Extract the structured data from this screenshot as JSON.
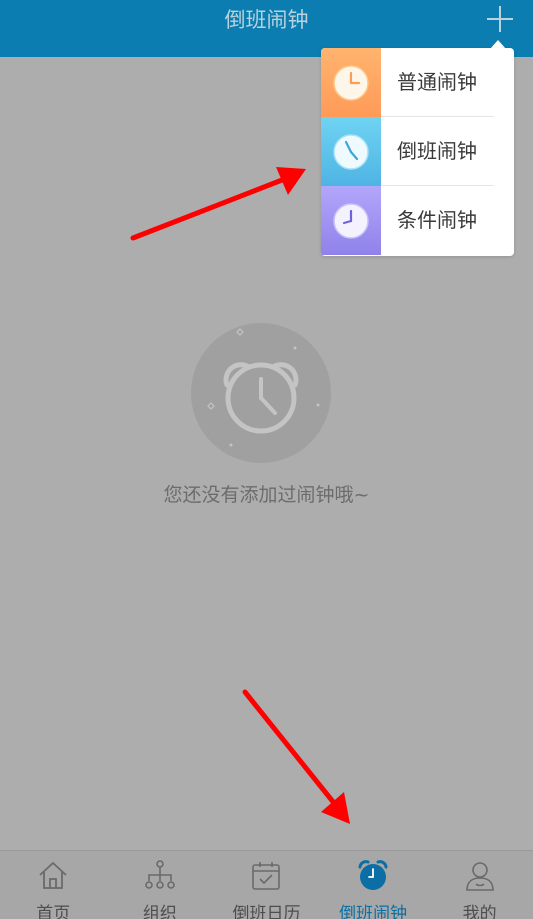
{
  "header": {
    "title": "倒班闹钟",
    "add_icon": "plus-icon"
  },
  "popup_menu": {
    "items": [
      {
        "label": "普通闹钟",
        "icon": "clock-icon",
        "color": "#ffa35e"
      },
      {
        "label": "倒班闹钟",
        "icon": "clock-icon",
        "color": "#57bde6"
      },
      {
        "label": "条件闹钟",
        "icon": "clock-icon",
        "color": "#9a8cf0"
      }
    ]
  },
  "empty_state": {
    "icon": "alarm-clock-icon",
    "message": "您还没有添加过闹钟哦~"
  },
  "tabbar": {
    "active_color": "#0b6fa5",
    "items": [
      {
        "label": "首页",
        "icon": "home-icon"
      },
      {
        "label": "组织",
        "icon": "org-chart-icon"
      },
      {
        "label": "倒班日历",
        "icon": "calendar-icon"
      },
      {
        "label": "倒班闹钟",
        "icon": "alarm-clock-icon",
        "active": true
      },
      {
        "label": "我的",
        "icon": "user-icon"
      }
    ]
  }
}
